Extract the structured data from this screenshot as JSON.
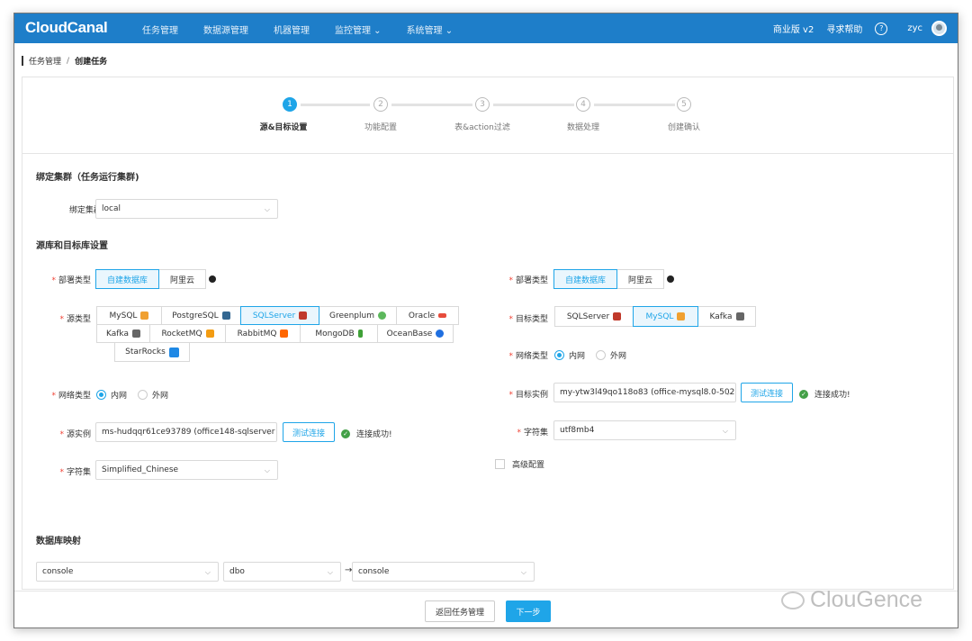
{
  "brand": {
    "logo": "CloudCanal"
  },
  "nav": {
    "items": [
      "任务管理",
      "数据源管理",
      "机器管理",
      "监控管理 ⌄",
      "系统管理 ⌄"
    ],
    "edition": "商业版 v2",
    "help": "寻求帮助",
    "help_symbol": "?",
    "user": "zyc"
  },
  "breadcrumb": {
    "parent": "任务管理",
    "separator": "/",
    "current": "创建任务"
  },
  "steps": [
    {
      "num": "1",
      "label": "源&目标设置",
      "active": true
    },
    {
      "num": "2",
      "label": "功能配置",
      "active": false
    },
    {
      "num": "3",
      "label": "表&action过滤",
      "active": false
    },
    {
      "num": "4",
      "label": "数据处理",
      "active": false
    },
    {
      "num": "5",
      "label": "创建确认",
      "active": false
    }
  ],
  "cluster": {
    "section_title": "绑定集群（任务运行集群)",
    "label": "绑定集群",
    "value": "local"
  },
  "db_section_title": "源库和目标库设置",
  "source": {
    "deploy_label": "部署类型",
    "deploy_options": [
      "自建数据库",
      "阿里云"
    ],
    "type_label": "源类型",
    "types_row1": [
      "MySQL",
      "PostgreSQL",
      "SQLServer",
      "Greenplum",
      "Oracle"
    ],
    "types_row2": [
      "Kafka",
      "RocketMQ",
      "RabbitMQ",
      "MongoDB",
      "OceanBase"
    ],
    "types_row3": [
      "StarRocks"
    ],
    "selected_type": "SQLServer",
    "network_label": "网络类型",
    "network_options": [
      "内网",
      "外网"
    ],
    "instance_label": "源实例",
    "instance_value": "ms-hudqqr61ce93789 (office148-sqlserver",
    "test_button": "测试连接",
    "test_result": "连接成功!",
    "charset_label": "字符集",
    "charset_value": "Simplified_Chinese"
  },
  "target": {
    "deploy_label": "部署类型",
    "deploy_options": [
      "自建数据库",
      "阿里云"
    ],
    "type_label": "目标类型",
    "types": [
      "SQLServer",
      "MySQL",
      "Kafka"
    ],
    "selected_type": "MySQL",
    "network_label": "网络类型",
    "network_options": [
      "内网",
      "外网"
    ],
    "instance_label": "目标实例",
    "instance_value": "my-ytw3l49qo118o83 (office-mysql8.0-502",
    "test_button": "测试连接",
    "test_result": "连接成功!",
    "charset_label": "字符集",
    "charset_value": "utf8mb4",
    "advanced_label": "高级配置"
  },
  "mapping": {
    "section_title": "数据库映射",
    "source_db": "console",
    "source_schema": "dbo",
    "arrow": "→",
    "target_db": "console"
  },
  "footer": {
    "back_button": "返回任务管理",
    "next_button": "下一步"
  },
  "watermark": "ClouGence",
  "colors": {
    "header": "#1e7ec9",
    "accent": "#1fa5e8",
    "success": "#43a047",
    "required": "#f04134"
  }
}
